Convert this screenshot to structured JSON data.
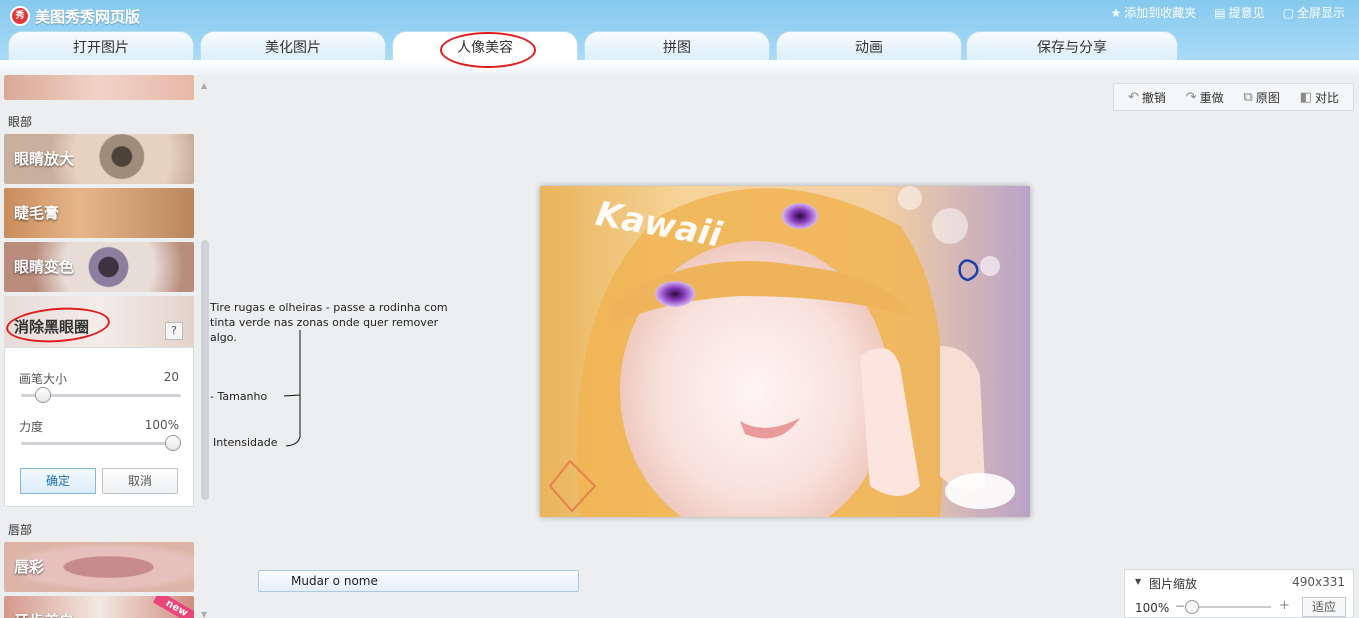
{
  "app": {
    "title": "美图秀秀网页版",
    "logo_text": "秀"
  },
  "top_links": [
    {
      "icon": "star-icon",
      "glyph": "★",
      "label": "添加到收藏夹"
    },
    {
      "icon": "comment-icon",
      "glyph": "▤",
      "label": "提意见"
    },
    {
      "icon": "fullscreen-icon",
      "glyph": "▢",
      "label": "全屏显示"
    }
  ],
  "tabs": [
    {
      "label": "打开图片"
    },
    {
      "label": "美化图片"
    },
    {
      "label": "人像美容",
      "active": true
    },
    {
      "label": "拼图"
    },
    {
      "label": "动画"
    },
    {
      "label": "保存与分享"
    }
  ],
  "left_panel": {
    "eye_section": "眼部",
    "lip_section": "唇部",
    "items": [
      {
        "label": "眼睛放大"
      },
      {
        "label": "睫毛膏"
      },
      {
        "label": "眼睛变色"
      },
      {
        "label": "消除黑眼圈"
      },
      {
        "label": "唇彩"
      },
      {
        "label": "牙齿美白"
      }
    ],
    "help_label": "?",
    "tool": {
      "brush_label": "画笔大小",
      "brush_value": "20",
      "brush_fraction": 0.1,
      "strength_label": "力度",
      "strength_value": "100%",
      "strength_fraction": 1.0,
      "ok_label": "确定",
      "cancel_label": "取消"
    },
    "new_badge": "new"
  },
  "annotations": {
    "main": "Tire rugas e olheiras - passe a rodinha com tinta verde nas zonas onde quer remover algo.",
    "size": "- Tamanho",
    "intensity": "Intensidade"
  },
  "toolbar": [
    {
      "icon": "undo-icon",
      "glyph": "↶",
      "label": "撤销"
    },
    {
      "icon": "redo-icon",
      "glyph": "↷",
      "label": "重做"
    },
    {
      "icon": "original-icon",
      "glyph": "⧉",
      "label": "原图"
    },
    {
      "icon": "compare-icon",
      "glyph": "◧",
      "label": "对比"
    }
  ],
  "photo": {
    "overlay_text": "Kawaii"
  },
  "rename": {
    "label": "Mudar o nome"
  },
  "zoom": {
    "title": "图片缩放",
    "size": "490x331",
    "value": "100%",
    "minus": "−",
    "plus": "+",
    "fit_label": "适应",
    "fraction": 0.0
  },
  "colors": {
    "header": "#9fd6f5",
    "annotation_circle": "#e01b1b"
  }
}
